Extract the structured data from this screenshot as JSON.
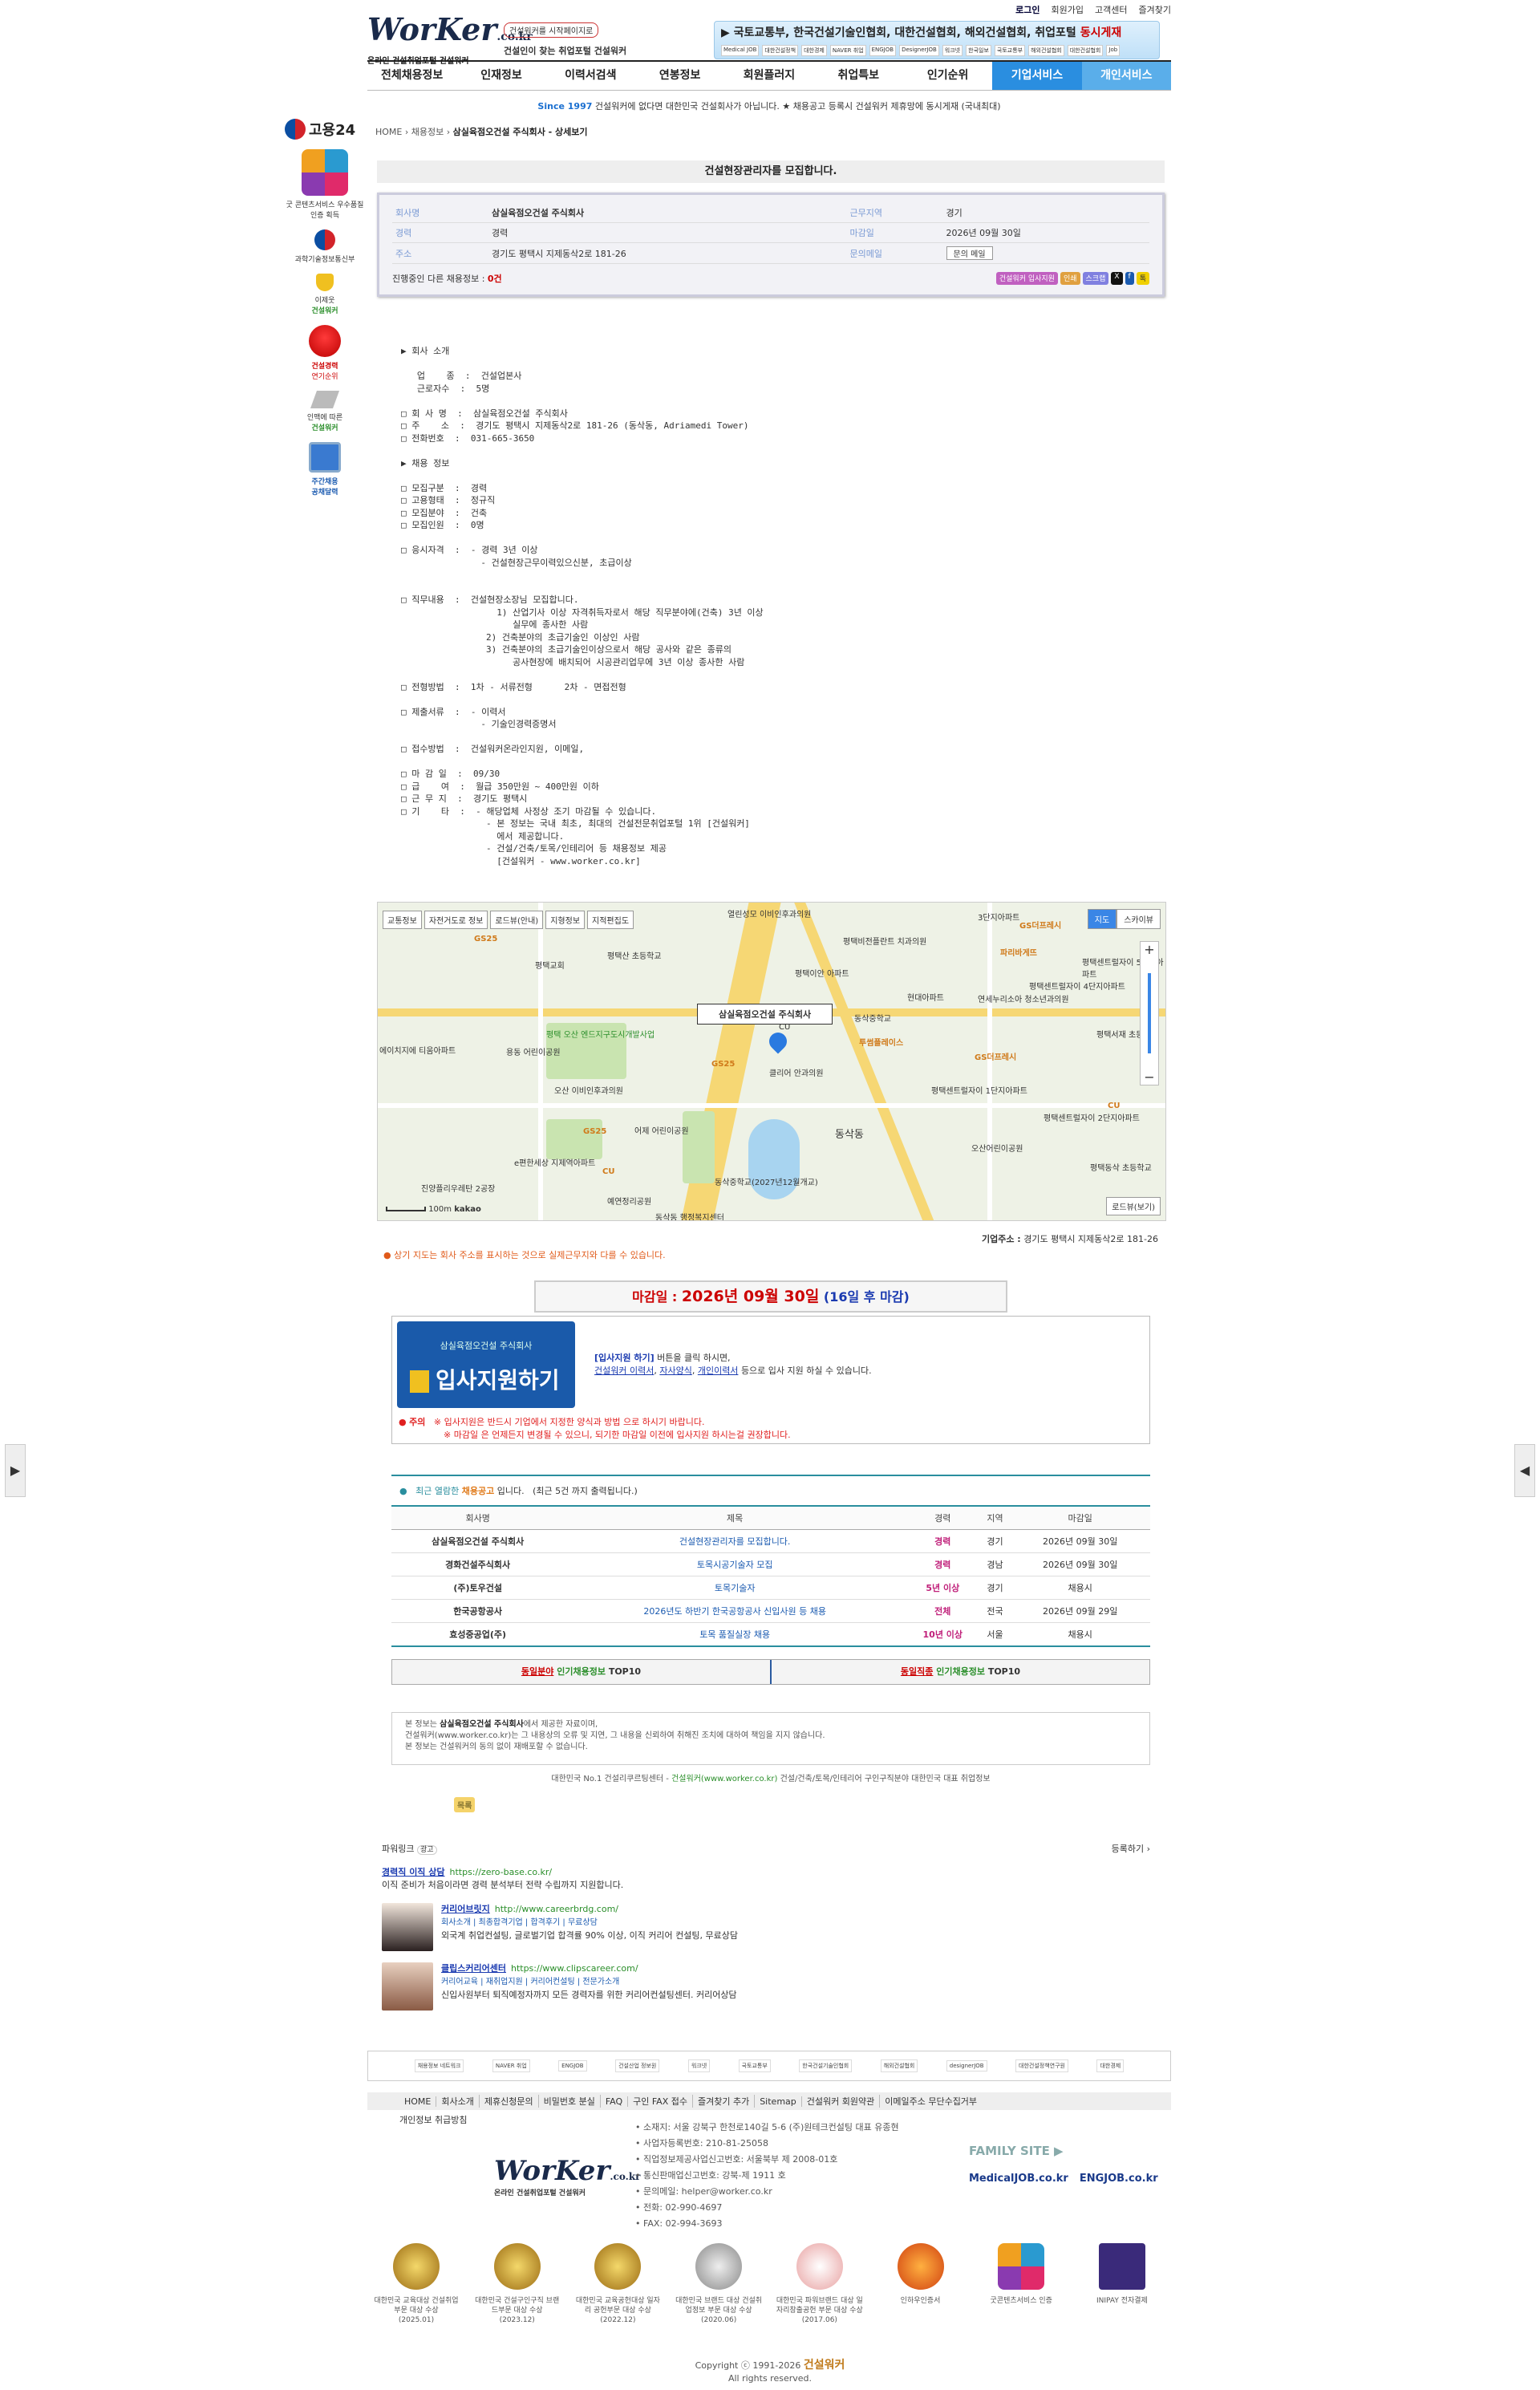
{
  "header": {
    "logo_text": "WorKer",
    "logo_domain": ".co.kr",
    "logo_tagline": "온라인 건설취업포털 건설워커",
    "promo_pill": "건설워커를 시작페이지로",
    "promo_text": "건설인이 찾는 취업포털 건설워커",
    "top_links": [
      "로그인",
      "회원가입",
      "고객센터",
      "즐겨찾기"
    ],
    "partner_text": "국토교통부, 한국건설기술인협회, 대한건설협회, 해외건설협회, 취업포털",
    "partner_highlight": "동시게재",
    "partner_logos": [
      "Medical JOB",
      "대한건설정책",
      "대한경제",
      "NAVER 취업",
      "ENGJOB",
      "DesignerJOB",
      "워크넷",
      "한국일보",
      "국토교통부",
      "해외건설협회",
      "대한건설협회",
      "Job"
    ]
  },
  "nav": {
    "items": [
      "전체채용정보",
      "인재정보",
      "이력서검색",
      "연봉정보",
      "회원플러지",
      "취업특보",
      "인기순위"
    ],
    "biz": "기업서비스",
    "per": "개인서비스"
  },
  "notice": {
    "since": "Since 1997",
    "text": "건설워커에 없다면 대한민국 건설회사가 아닙니다. ★ 채용공고 등록시 건설워커 제휴망에 동시게재 (국내최대)"
  },
  "left": {
    "goyong": "고용24",
    "ad1": "굿 콘텐츠서비스 우수품질인증 획득",
    "ad2": "과학기술정보통신부",
    "ad3_l1": "이제웃",
    "ad3_l2": "건설워커",
    "ad4_l1": "건설경력",
    "ad4_l2": "연기순위",
    "ad5_l1": "인맥에 따른",
    "ad5_l2": "건설워커",
    "ad6_l1": "주간채용",
    "ad6_l2": "공채달력"
  },
  "breadcrumb": {
    "home": "HOME",
    "cat": "채용정보",
    "current": "삼실육점오건설 주식회사 - 상세보기"
  },
  "job": {
    "title": "건설현장관리자를 모집합니다.",
    "rows": [
      {
        "k1": "회사명",
        "v1": "삼실육점오건설 주식회사",
        "k2": "근무지역",
        "v2": "경기"
      },
      {
        "k1": "경력",
        "v1": "경력",
        "k2": "마감일",
        "v2": "2026년 09월 30일"
      },
      {
        "k1": "주소",
        "v1": "경기도 평택시 지제동삭2로 181-26",
        "k2": "문의메일",
        "v2": "문의 메일"
      }
    ],
    "other_label": "진행중인 다른 채용정보 :",
    "other_count": "0건",
    "buttons": [
      "건설워커 입사지원",
      "인쇄",
      "스크랩",
      "X",
      "f",
      "톡"
    ]
  },
  "desc": "▶ 회사 소개\n\n   업    종  :  건설업본사\n   근로자수  :  5명\n\n□ 회 사 명  :  삼실육점오건설 주식회사\n□ 주    소  :  경기도 평택시 지제동삭2로 181-26 (동삭동, Adriamedi Tower)\n□ 전화번호  :  031-665-3650\n\n▶ 채용 정보\n\n□ 모집구분  :  경력\n□ 고용형태  :  정규직\n□ 모집분야  :  건축\n□ 모집인원  :  0명\n\n□ 응시자격  :  - 경력 3년 이상\n               - 건설현장근무이력있으신분, 초급이상\n\n\n□ 직무내용  :  건설현장소장님 모집합니다.\n                  1) 산업기사 이상 자격취득자로서 해당 직무분야에(건축) 3년 이상\n                     실무에 종사한 사람\n                2) 건축분야의 초급기술인 이상인 사람\n                3) 건축분야의 초급기술인이상으로서 해당 공사와 같은 종류의\n                     공사현장에 배치되어 시공관리업무에 3년 이상 종사한 사람\n\n□ 전형방법  :  1차 - 서류전형      2차 - 면접전형\n\n□ 제출서류  :  - 이력서\n               - 기술인경력증명서\n\n□ 접수방법  :  건설워커온라인지원, 이메일,\n\n□ 마 감 일  :  09/30\n□ 급    여  :  월급 350만원 ~ 400만원 이하\n□ 근 무 지  :  경기도 평택시\n□ 기    타  :  - 해당업체 사정상 조기 마감될 수 있습니다.\n                - 본 정보는 국내 최초, 최대의 건설전문취업포털 1위 [건설워커]\n                  에서 제공합니다.\n                - 건설/건축/토목/인테리어 등 채용정보 제공\n                  [건설워커 - www.worker.co.kr]",
  "map": {
    "tools": [
      "교통정보",
      "자전거도로 정보",
      "로드뷰(안내)",
      "지형정보",
      "지적편집도"
    ],
    "type_map": "지도",
    "type_sky": "스카이뷰",
    "marker": "삼실육점오건설 주식회사",
    "roadview": "로드뷰(보기)",
    "scale": "100m",
    "brand": "kakao",
    "labels": [
      "열린성모 이비인후과의원",
      "평택비전플란트 치과의원",
      "평택교회",
      "평택이안 아파트",
      "현대아파트",
      "연세누리소아 청소년과의원",
      "평택센트럴자이 5단지아파트",
      "평택센트럴자이 4단지아파트",
      "평택서재 초등학교",
      "동삭중학교",
      "평택센트럴자이 1단지아파트",
      "평택센트럴자이 2단지아파트",
      "동삭동",
      "평택동삭 초등학교",
      "에이치지에 티움아파트",
      "용동 어린이공원",
      "오산 이비인후과의원",
      "어제 어린이공원",
      "e편한세상 지제역아파트",
      "진양플리우레탄 2공장",
      "모산골어린이공원",
      "평택 오산 엔드지구도시개발사업",
      "평택산 초등학교",
      "이동 어린이공원",
      "GS25",
      "CU",
      "GS더프레시",
      "세종가정의학과 치과의원",
      "클리어 안과의원",
      "동삭중학교(2027년12월개교)",
      "예연정리공원",
      "오산어린이공원",
      "동삭동 행정복지센터",
      "투썸플레이스",
      "파리바게뜨",
      "3단지아파트"
    ]
  },
  "address": {
    "label": "기업주소 :",
    "value": "경기도 평택시 지제동삭2로 181-26"
  },
  "map_note": "상기 지도는 회사 주소를 표시하는 것으로 실제근무지와 다를 수 있습니다.",
  "deadline": {
    "label": "마감일 :",
    "date": "2026년 09월 30일",
    "remain": "(16일 후 마감)"
  },
  "apply": {
    "company": "삼실육점오건설 주식회사",
    "button": "입사지원하기",
    "line1_bl": "[입사지원 하기]",
    "line1": "버튼을 클릭 하시면,",
    "link1": "건설워커 이력서",
    "link2": "자사양식",
    "link3": "개인이력서",
    "line2": "등으로 입사 지원 하실 수 있습니다.",
    "warn_label": "주의",
    "warn1": "※ 입사지원은 반드시 기업에서 지정한 양식과 방법 으로 하시기 바랍니다.",
    "warn2": "※ 마감일 은 언제든지 변경될 수 있으니, 되기한 마감일 이전에 입사지원 하시는걸 권장합니다."
  },
  "recent": {
    "head_a": "최근 열람한",
    "head_b": "채용공고",
    "head_c": "입니다.",
    "head_d": "(최근 5건 까지 출력됩니다.)",
    "columns": [
      "회사명",
      "제목",
      "경력",
      "지역",
      "마감일"
    ],
    "rows": [
      [
        "삼실육점오건설 주식회사",
        "건설현장관리자를 모집합니다.",
        "경력",
        "경기",
        "2026년 09월 30일"
      ],
      [
        "경화건설주식회사",
        "토목시공기술자 모집",
        "경력",
        "경남",
        "2026년 09월 30일"
      ],
      [
        "(주)토우건설",
        "토목기술자",
        "5년 이상",
        "경기",
        "채용시"
      ],
      [
        "한국공항공사",
        "2026년도 하반기 한국공항공사 신입사원 등 채용",
        "전체",
        "전국",
        "2026년 09월 29일"
      ],
      [
        "효성중공업(주)",
        "토목 품질실장 채용",
        "10년 이상",
        "서울",
        "채용시"
      ]
    ]
  },
  "top10": {
    "a_r": "동일분야",
    "a_g": "인기채용정보",
    "a_t": "TOP10",
    "b_r": "동일직종",
    "b_g": "인기채용정보",
    "b_t": "TOP10"
  },
  "source": {
    "l1a": "본 정보는",
    "l1b": "삼실육점오건설 주식회사",
    "l1c": "에서 제공한 자료이며,",
    "l2": "건설워커(www.worker.co.kr)는 그 내용상의 오류 및 지연, 그 내용을 신뢰하여 취해진 조치에 대하여 책임을 지지 않습니다.",
    "l3": "본 정보는 건설워커의 동의 없이 재배포할 수 없습니다.",
    "line_a": "대한민국 No.1 건설리쿠르팅센터 -",
    "line_b": "건설워커(www.worker.co.kr)",
    "line_c": "건설/건축/토목/인테리어 구인구직분야 대한민국 대표 취업정보",
    "pill": "목록"
  },
  "powerlink": {
    "title": "파워링크",
    "ad": "광고",
    "register": "등록하기 ›",
    "items": [
      {
        "t": "경력직 이직 상담",
        "u": "https://zero-base.co.kr/",
        "sub": "",
        "d": "이직 준비가 처음이라면 경력 분석부터 전략 수립까지 지원합니다."
      },
      {
        "t": "커리어브릿지",
        "u": "http://www.careerbrdg.com/",
        "sub": "회사소개 | 최종합격기업 | 합격후기 | 무료상담",
        "d": "외국계 취업컨설팅, 글로벌기업 합격률 90% 이상, 이직 커리어 컨설팅, 무료상담"
      },
      {
        "t": "클립스커리어센터",
        "u": "https://www.clipscareer.com/",
        "sub": "커리어교육 | 재취업지원 | 커리어컨설팅 | 전문가소개",
        "d": "신입사원부터 퇴직예정자까지 모든 경력자를 위한 커리어컨설팅센터. 커리어상담"
      }
    ]
  },
  "footer": {
    "partners": [
      "채용정보 네트워크",
      "NAVER 취업",
      "ENGJOB",
      "건설산업 정보원",
      "워크넷",
      "국토교통부",
      "한국건설기술인협회",
      "해외건설협회",
      "designerJOB",
      "대한건설정책연구원",
      "대한경제"
    ],
    "nav": [
      "HOME",
      "회사소개",
      "제휴신청문의",
      "비밀번호 분실",
      "FAQ",
      "구인 FAX 접수",
      "즐겨찾기 추가",
      "Sitemap",
      "건설워커 회원약관",
      "이메일주소 무단수집거부"
    ],
    "privacy": "개인정보 취급방침",
    "info": [
      "소재지: 서울 강북구 한천로140길 5-6 (주)원테크컨설팅 대표 유종현",
      "사업자등록번호: 210-81-25058",
      "직업정보제공사업신고번호: 서울북부 제 2008-01호",
      "통신판매업신고번호: 강북-제 1911 호",
      "문의메일: helper@worker.co.kr",
      "전화: 02-990-4697",
      "FAX: 02-994-3693"
    ],
    "family_title": "FAMILY SITE",
    "family": [
      "MedicalJOB.co.kr",
      "ENGJOB.co.kr"
    ],
    "awards": [
      {
        "t": "대한민국 교육대상 건설취업부문 대상 수상",
        "d": "(2025.01)"
      },
      {
        "t": "대한민국 건설구인구직 브랜드부문 대상 수상",
        "d": "(2023.12)"
      },
      {
        "t": "대한민국 교육공헌대상 일자리 공헌부문 대상 수상",
        "d": "(2022.12)"
      },
      {
        "t": "대한민국 브랜드 대상 건설취업정보 부문 대상 수상",
        "d": "(2020.06)"
      },
      {
        "t": "대한민국 파워브랜드 대상 일자리창출공헌 부문 대상 수상",
        "d": "(2017.06)"
      },
      {
        "t": "인하우인증서",
        "d": ""
      },
      {
        "t": "굿콘텐츠서비스 인증",
        "d": ""
      },
      {
        "t": "INIPAY 전자결제",
        "d": ""
      }
    ],
    "copy": "Copyright ⓒ 1991-2026",
    "copy_brand": "건설워커",
    "rights": "All rights reserved."
  },
  "colors": {
    "accent": "#2a8ee0",
    "red": "#cc0000",
    "teal": "#2a8e9e"
  }
}
